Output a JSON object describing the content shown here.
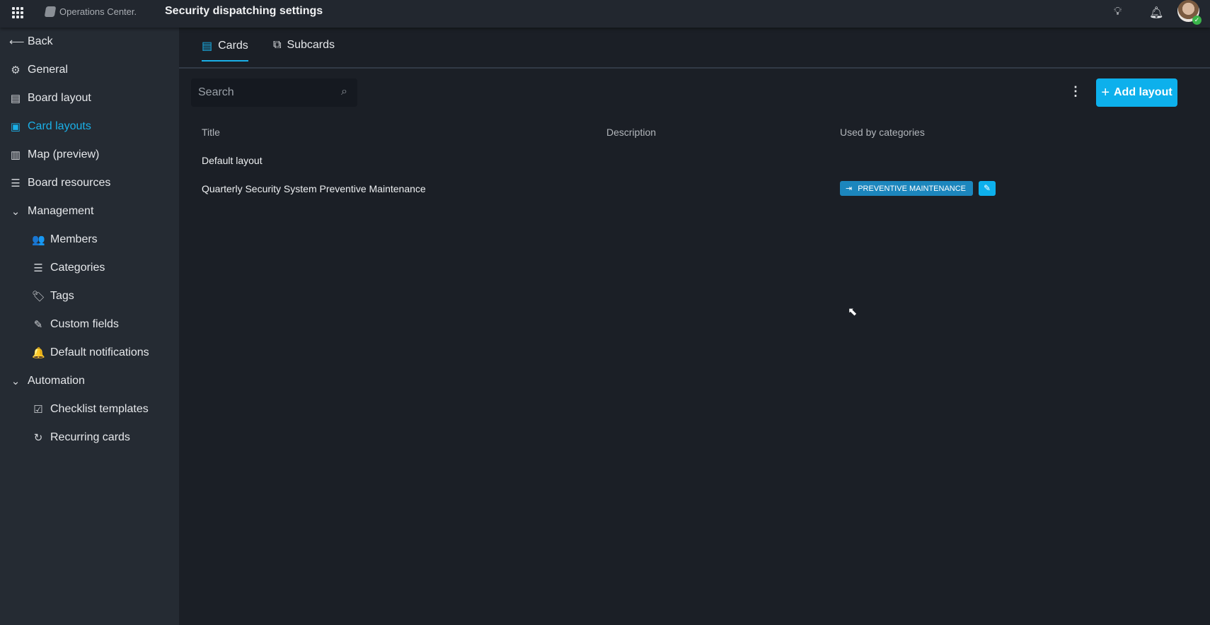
{
  "header": {
    "app_name": "Operations Center.",
    "title": "Security dispatching settings"
  },
  "sidebar": {
    "items": [
      {
        "label": "Back",
        "icon": "arrow-left-icon",
        "glyph": "⟵"
      },
      {
        "label": "General",
        "icon": "gear-icon",
        "glyph": "⚙"
      },
      {
        "label": "Board layout",
        "icon": "board-layout-icon",
        "glyph": "▤"
      },
      {
        "label": "Card layouts",
        "icon": "card-layout-icon",
        "glyph": "▣",
        "active": true
      },
      {
        "label": "Map (preview)",
        "icon": "map-icon",
        "glyph": "▥"
      },
      {
        "label": "Board resources",
        "icon": "filter-list-icon",
        "glyph": "☰"
      },
      {
        "label": "Management",
        "icon": "chevron-down-icon",
        "glyph": "⌄"
      },
      {
        "label": "Members",
        "icon": "users-icon",
        "glyph": "👥"
      },
      {
        "label": "Categories",
        "icon": "list-icon",
        "glyph": "☰"
      },
      {
        "label": "Tags",
        "icon": "tags-icon",
        "glyph": "🏷"
      },
      {
        "label": "Custom fields",
        "icon": "edit-icon",
        "glyph": "✎"
      },
      {
        "label": "Default notifications",
        "icon": "bell-icon",
        "glyph": "🔔"
      },
      {
        "label": "Automation",
        "icon": "chevron-down-icon",
        "glyph": "⌄"
      },
      {
        "label": "Checklist templates",
        "icon": "checklist-icon",
        "glyph": "☑"
      },
      {
        "label": "Recurring cards",
        "icon": "refresh-icon",
        "glyph": "↻"
      }
    ]
  },
  "tabs": [
    {
      "label": "Cards",
      "active": true
    },
    {
      "label": "Subcards"
    }
  ],
  "toolbar": {
    "search_placeholder": "Search",
    "add_label": "Add layout"
  },
  "table": {
    "columns": [
      "Title",
      "Description",
      "Used by categories"
    ],
    "rows": [
      {
        "title": "Default layout",
        "description": "",
        "categories": []
      },
      {
        "title": "Quarterly Security System Preventive Maintenance",
        "description": "",
        "categories": [
          "PREVENTIVE MAINTENANCE"
        ]
      }
    ]
  },
  "colors": {
    "accent": "#0db0ec",
    "tag": "#1c86bd"
  }
}
